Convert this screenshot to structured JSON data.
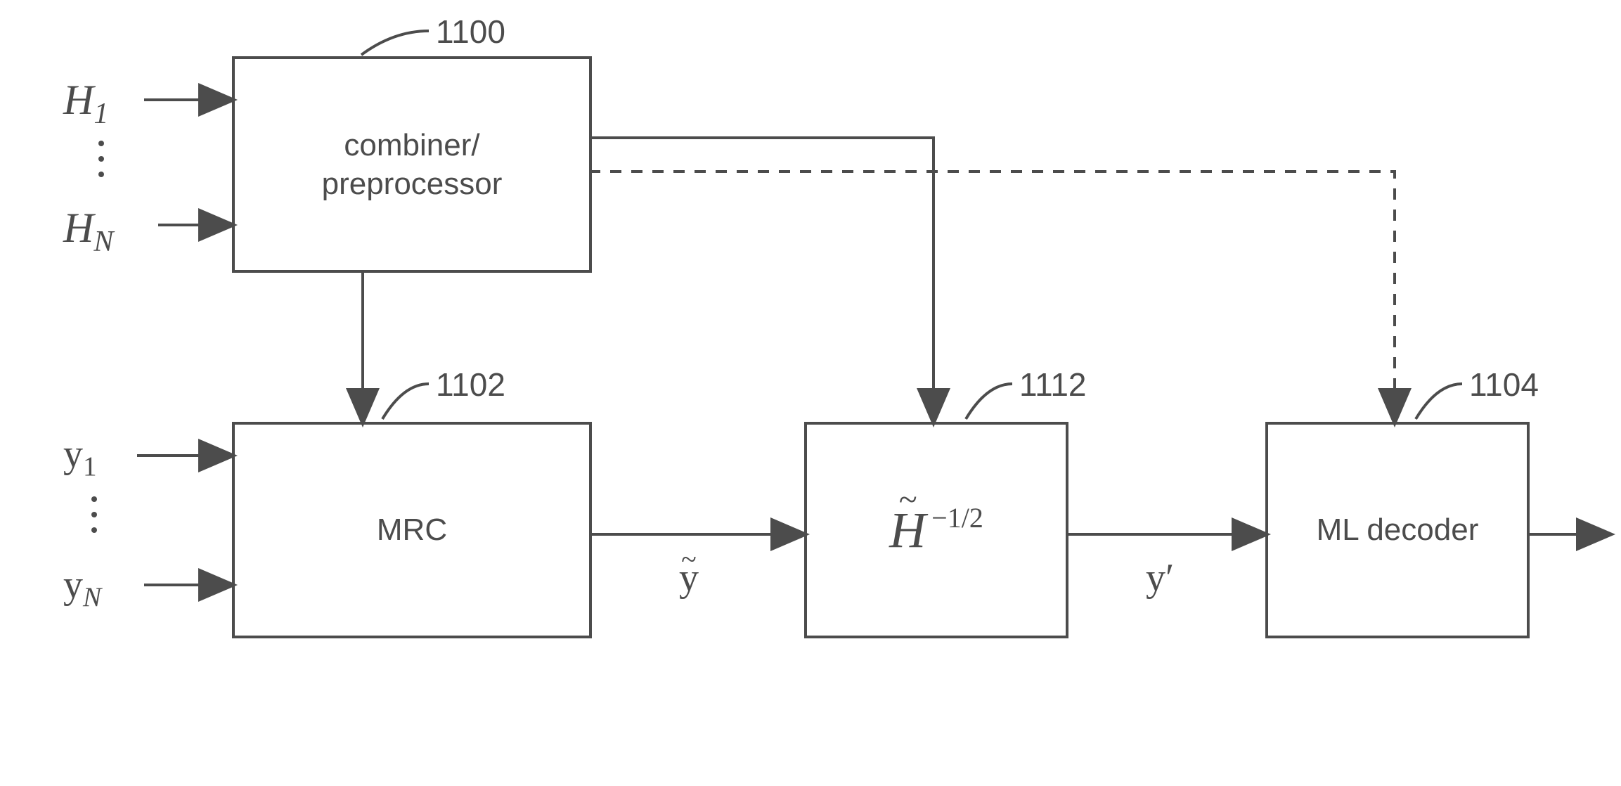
{
  "blocks": {
    "combiner": {
      "ref": "1100",
      "label_line1": "combiner/",
      "label_line2": "preprocessor"
    },
    "mrc": {
      "ref": "1102",
      "label": "MRC"
    },
    "hinv": {
      "ref": "1112",
      "H": "H",
      "exp": "−1/2"
    },
    "mldec": {
      "ref": "1104",
      "label": "ML decoder"
    }
  },
  "inputs": {
    "H_first": {
      "base": "H",
      "sub": "1"
    },
    "H_last": {
      "base": "H",
      "sub": "N"
    },
    "y_first": {
      "base": "y",
      "sub": "1"
    },
    "y_last": {
      "base": "y",
      "sub": "N"
    }
  },
  "signals": {
    "ytilde": {
      "base": "y",
      "tilde": "~"
    },
    "yprime": {
      "base": "y",
      "prime": "′"
    }
  }
}
